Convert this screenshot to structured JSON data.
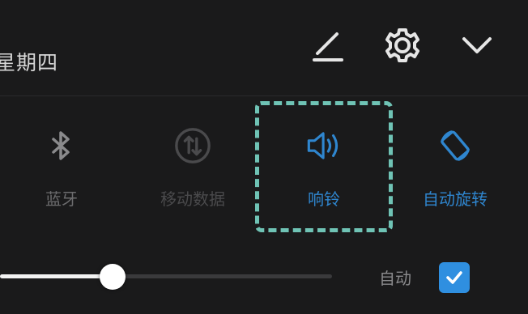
{
  "header": {
    "date_text": "星期四",
    "edit_icon": "pencil-edit-icon",
    "settings_icon": "gear-icon",
    "collapse_icon": "chevron-down-icon"
  },
  "quick_tiles": [
    {
      "label": "蓝牙",
      "icon": "bluetooth-icon",
      "state": "off"
    },
    {
      "label": "移动数据",
      "icon": "mobile-data-icon",
      "state": "disabled"
    },
    {
      "label": "响铃",
      "icon": "speaker-ring-icon",
      "state": "on",
      "focused": true
    },
    {
      "label": "自动旋转",
      "icon": "auto-rotate-icon",
      "state": "on"
    }
  ],
  "brightness": {
    "level": 0.34,
    "auto_label": "自动",
    "auto_checked": true
  },
  "colors": {
    "accent": "#2f86cf",
    "checkbox": "#2f8fe0",
    "focus_outline": "#6fc3b5",
    "background": "#1a1a1b"
  }
}
